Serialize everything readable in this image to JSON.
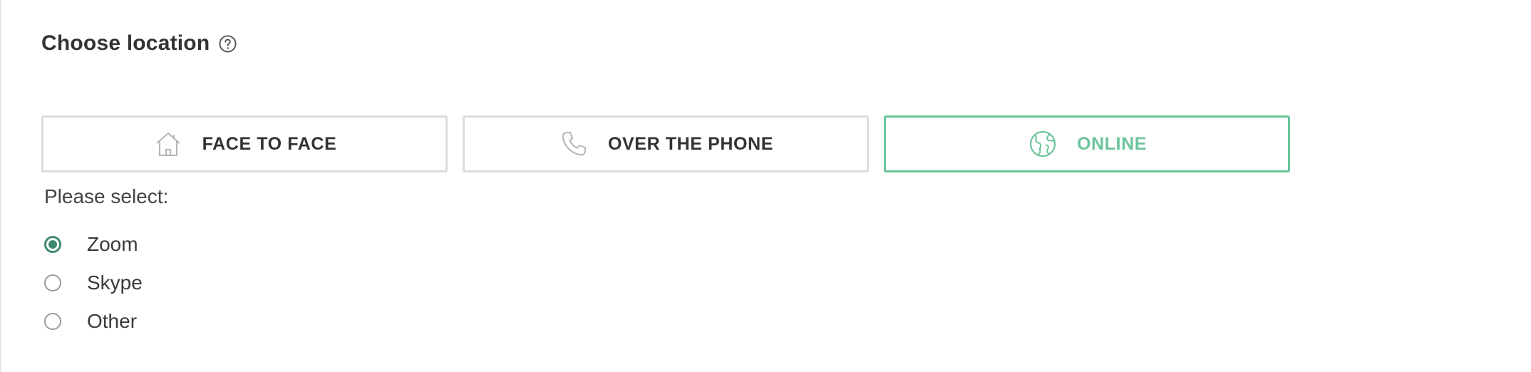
{
  "section": {
    "title": "Choose location",
    "help_icon": "question-circle-icon"
  },
  "location_options": [
    {
      "label": "FACE TO FACE",
      "icon": "house-icon",
      "selected": false
    },
    {
      "label": "OVER THE PHONE",
      "icon": "phone-icon",
      "selected": false
    },
    {
      "label": "ONLINE",
      "icon": "globe-icon",
      "selected": true
    }
  ],
  "online_platform": {
    "prompt": "Please select:",
    "options": [
      {
        "label": "Zoom",
        "checked": true
      },
      {
        "label": "Skype",
        "checked": false
      },
      {
        "label": "Other",
        "checked": false
      }
    ]
  },
  "colors": {
    "accent": "#6cc49a",
    "radio_checked": "#3f8a6e",
    "border": "#dcdcdc",
    "text": "#333333"
  }
}
